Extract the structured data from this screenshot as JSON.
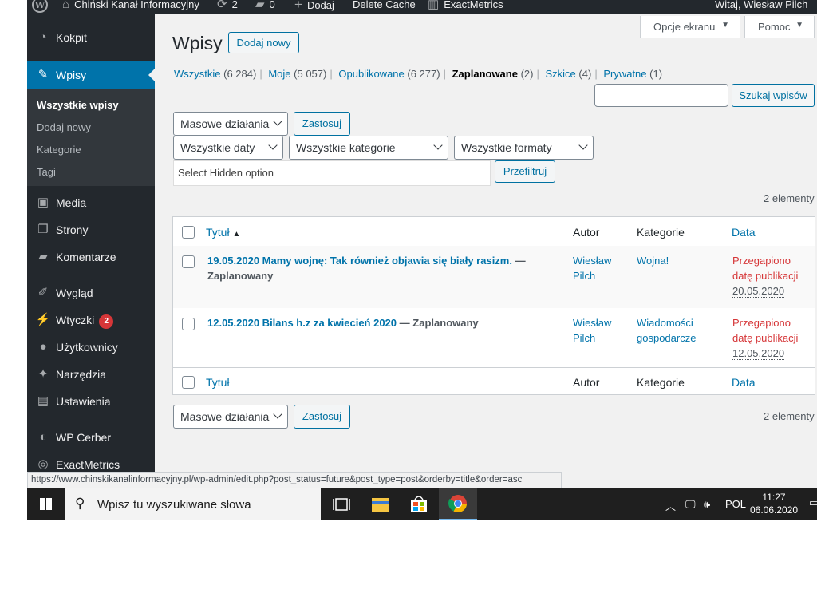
{
  "admin_bar": {
    "site_name": "Chiński Kanał Informacyjny",
    "updates_count": "2",
    "comments_count": "0",
    "add_label": "Dodaj",
    "delete_cache_label": "Delete Cache",
    "exactmetrics_label": "ExactMetrics",
    "greeting": "Witaj, Wiesław Pilch"
  },
  "sidebar": {
    "items": [
      {
        "label": "Kokpit",
        "icon": "dashboard-icon"
      },
      {
        "label": "Wpisy",
        "icon": "pin-icon"
      },
      {
        "label": "Media",
        "icon": "media-icon"
      },
      {
        "label": "Strony",
        "icon": "page-icon"
      },
      {
        "label": "Komentarze",
        "icon": "comment-icon"
      },
      {
        "label": "Wygląd",
        "icon": "brush-icon"
      },
      {
        "label": "Wtyczki",
        "icon": "plugin-icon",
        "badge": "2"
      },
      {
        "label": "Użytkownicy",
        "icon": "user-icon"
      },
      {
        "label": "Narzędzia",
        "icon": "wrench-icon"
      },
      {
        "label": "Ustawienia",
        "icon": "settings-icon"
      },
      {
        "label": "WP Cerber",
        "icon": "cerber-icon"
      },
      {
        "label": "ExactMetrics",
        "icon": "exactmetrics-icon"
      }
    ],
    "submenu": [
      "Wszystkie wpisy",
      "Dodaj nowy",
      "Kategorie",
      "Tagi"
    ]
  },
  "header": {
    "title": "Wpisy",
    "add_new": "Dodaj nowy",
    "screen_options": "Opcje ekranu",
    "help": "Pomoc"
  },
  "views": [
    {
      "label": "Wszystkie",
      "count": "(6 284)"
    },
    {
      "label": "Moje",
      "count": "(5 057)"
    },
    {
      "label": "Opublikowane",
      "count": "(6 277)"
    },
    {
      "label": "Zaplanowane",
      "count": "(2)"
    },
    {
      "label": "Szkice",
      "count": "(4)"
    },
    {
      "label": "Prywatne",
      "count": "(1)"
    }
  ],
  "search": {
    "value": "",
    "button": "Szukaj wpisów"
  },
  "bulk": {
    "label": "Masowe działania",
    "apply": "Zastosuj"
  },
  "filters": {
    "dates": "Wszystkie daty",
    "categories": "Wszystkie kategorie",
    "formats": "Wszystkie formaty",
    "hidden_option": "Select Hidden option",
    "filter_button": "Przefiltruj"
  },
  "items_count": "2 elementy",
  "table": {
    "columns": {
      "title": "Tytuł",
      "author": "Autor",
      "categories": "Kategorie",
      "date": "Data"
    },
    "rows": [
      {
        "title": "19.05.2020 Mamy wojnę: Tak również objawia się biały rasizm.",
        "state": "Zaplanowany",
        "author_1": "Wiesław",
        "author_2": "Pilch",
        "cat_1": "Wojna!",
        "cat_2": "",
        "status_1": "Przegapiono",
        "status_2": "datę publikacji",
        "date": "20.05.2020"
      },
      {
        "title": "12.05.2020 Bilans h.z za kwiecień 2020",
        "state": "Zaplanowany",
        "author_1": "Wiesław",
        "author_2": "Pilch",
        "cat_1": "Wiadomości",
        "cat_2": "gospodarcze",
        "status_1": "Przegapiono",
        "status_2": "datę publikacji",
        "date": "12.05.2020"
      }
    ]
  },
  "status_url": "https://www.chinskikanalinformacyjny.pl/wp-admin/edit.php?post_status=future&post_type=post&orderby=title&order=asc",
  "taskbar": {
    "search_placeholder": "Wpisz tu wyszukiwane słowa",
    "lang": "POL",
    "time": "11:27",
    "date": "06.06.2020"
  }
}
